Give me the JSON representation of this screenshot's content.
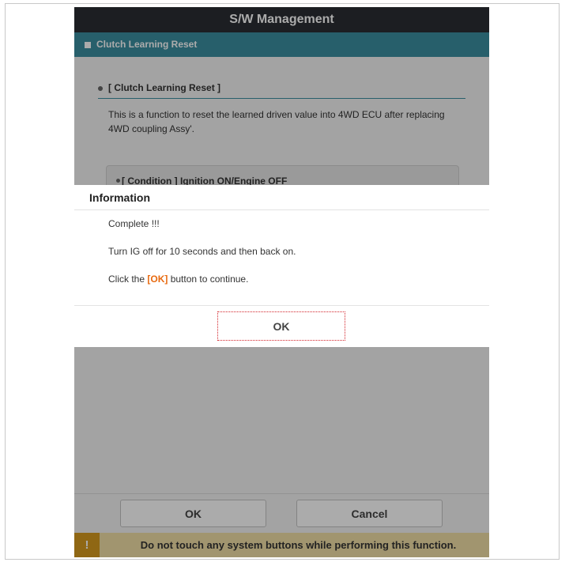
{
  "app": {
    "title": "S/W Management"
  },
  "section": {
    "label": "Clutch Learning Reset"
  },
  "content": {
    "sub_heading": "[ Clutch Learning Reset ]",
    "description": "This is a function to reset the learned driven value into 4WD ECU after replacing 4WD coupling Assy'.",
    "condition": "[ Condition ] Ignition ON/Engine OFF"
  },
  "footer": {
    "ok_label": "OK",
    "cancel_label": "Cancel"
  },
  "warning": {
    "icon": "exclamation-icon",
    "icon_glyph": "!",
    "text": "Do not touch any system buttons while performing this function."
  },
  "dialog": {
    "title": "Information",
    "line1": "Complete !!!",
    "line2": "Turn IG off for 10 seconds and then back on.",
    "line3_prefix": "Click the ",
    "line3_highlight": "[OK]",
    "line3_suffix": " button to continue.",
    "ok_label": "OK"
  },
  "colors": {
    "titlebar": "#2a2e33",
    "section_bar": "#3b8ea0",
    "highlight": "#e86a10",
    "warning_bg": "#f1dfa6",
    "warning_icon": "#d69a1e"
  }
}
